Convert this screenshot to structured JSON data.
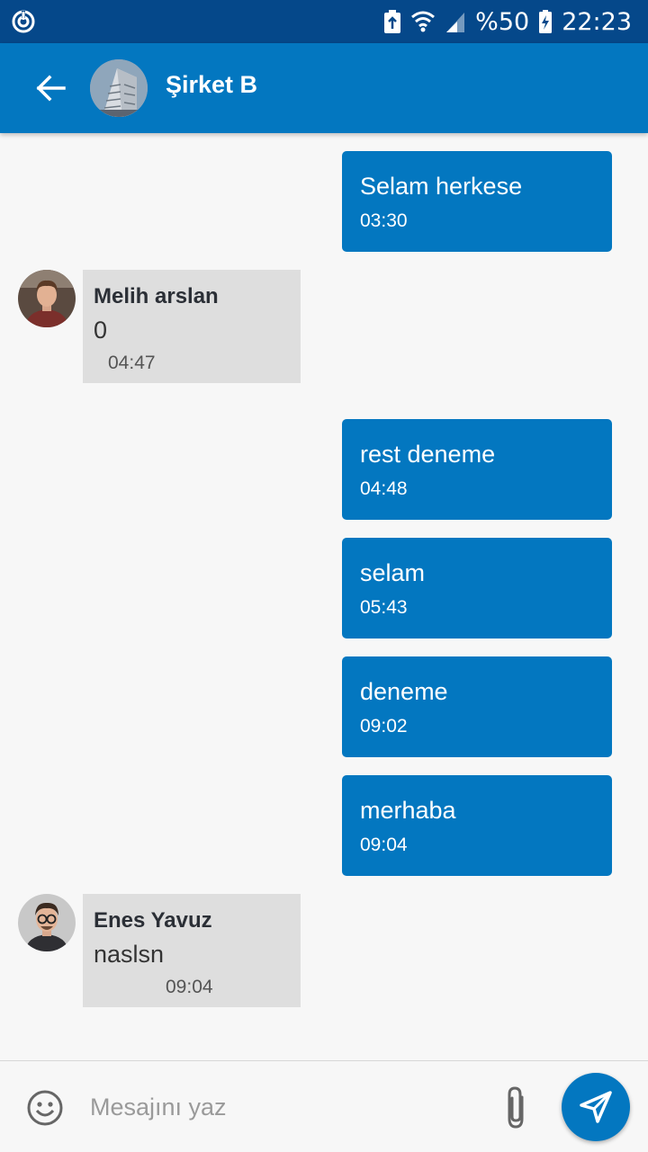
{
  "status_bar": {
    "battery_percent": "%50",
    "time": "22:23",
    "icons": [
      "sync-icon",
      "battery-saver-icon",
      "wifi-icon",
      "signal-icon",
      "battery-charging-icon"
    ]
  },
  "header": {
    "title": "Şirket B",
    "back_icon": "arrow-left-icon"
  },
  "messages": [
    {
      "direction": "out",
      "text": "Selam herkese",
      "time": "03:30"
    },
    {
      "direction": "in",
      "sender": "Melih arslan",
      "text": "0",
      "time": "04:47"
    },
    {
      "direction": "out",
      "text": "rest deneme",
      "time": "04:48"
    },
    {
      "direction": "out",
      "text": "selam",
      "time": "05:43"
    },
    {
      "direction": "out",
      "text": "deneme",
      "time": "09:02"
    },
    {
      "direction": "out",
      "text": "merhaba",
      "time": "09:04"
    },
    {
      "direction": "in",
      "sender": "Enes Yavuz",
      "text": "naslsn",
      "time": "09:04"
    }
  ],
  "composer": {
    "placeholder": "Mesajını yaz",
    "value": "",
    "icons": [
      "emoji-icon",
      "paperclip-icon",
      "send-icon"
    ]
  },
  "colors": {
    "status_bar": "#05488a",
    "primary": "#0377c0",
    "incoming_bubble": "#dedede",
    "background": "#f7f7f7"
  }
}
